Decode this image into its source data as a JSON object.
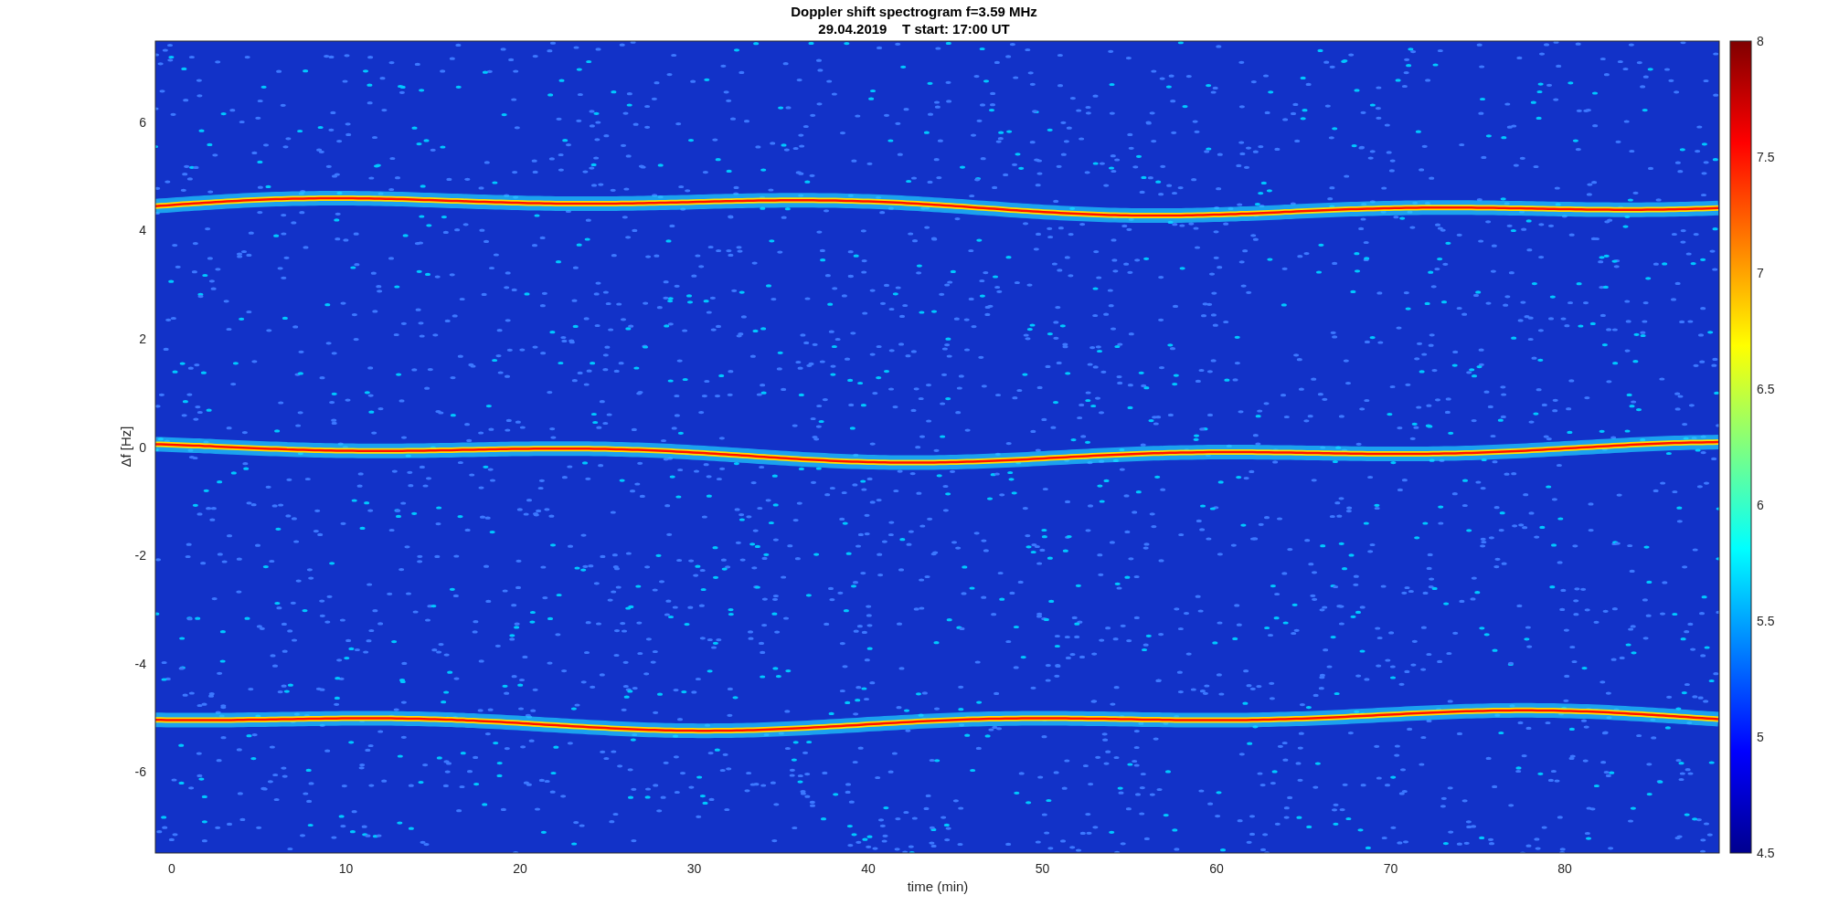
{
  "figure": {
    "title": "Doppler shift spectrogram f=3.59 MHz",
    "subtitle": "29.04.2019    T start: 17:00 UT"
  },
  "axes": {
    "xlabel": "time (min)",
    "ylabel": "Δf [Hz]",
    "xticks": [
      "0",
      "10",
      "20",
      "30",
      "40",
      "50",
      "60",
      "70",
      "80"
    ],
    "yticks": [
      "6",
      "4",
      "2",
      "0",
      "-2",
      "-4",
      "-6"
    ]
  },
  "colorbar": {
    "ticks": [
      "8",
      "7.5",
      "7",
      "6.5",
      "6",
      "5.5",
      "5",
      "4.5"
    ]
  }
}
